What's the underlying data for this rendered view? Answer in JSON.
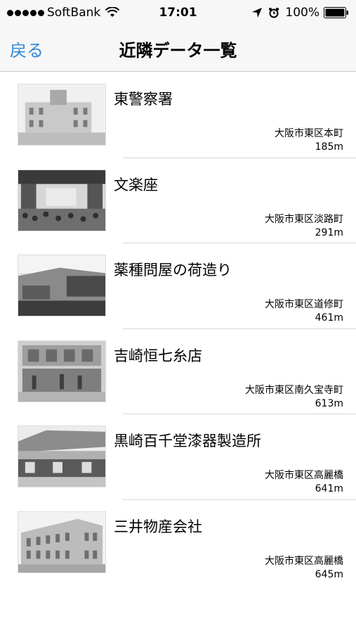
{
  "status_bar": {
    "carrier": "SoftBank",
    "time": "17:01",
    "battery": "100%"
  },
  "nav": {
    "back_label": "戻る",
    "title": "近隣データ一覧"
  },
  "items": [
    {
      "title": "東警察署",
      "address": "大阪市東区本町",
      "distance": "185m"
    },
    {
      "title": "文楽座",
      "address": "大阪市東区淡路町",
      "distance": "291m"
    },
    {
      "title": "薬種問屋の荷造り",
      "address": "大阪市東区道修町",
      "distance": "461m"
    },
    {
      "title": "吉崎恒七糸店",
      "address": "大阪市東区南久宝寺町",
      "distance": "613m"
    },
    {
      "title": "黒崎百千堂漆器製造所",
      "address": "大阪市東区高麗橋",
      "distance": "641m"
    },
    {
      "title": "三井物産会社",
      "address": "大阪市東区高麗橋",
      "distance": "645m"
    }
  ]
}
